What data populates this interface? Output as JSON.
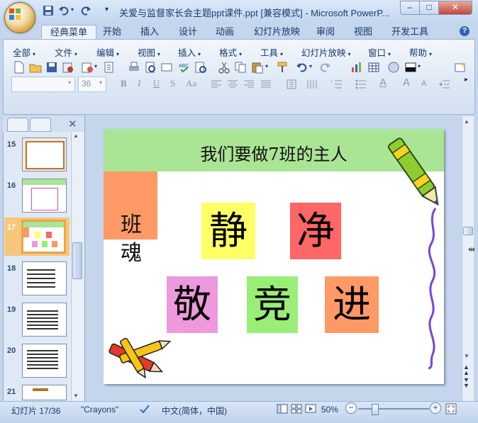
{
  "window": {
    "title": "关爱与监督家长会主题ppt课件.ppt [兼容模式] - Microsoft PowerP...",
    "minimize": "–",
    "maximize": "□",
    "close": "✕"
  },
  "ribbon_tabs": [
    "经典菜单",
    "开始",
    "插入",
    "设计",
    "动画",
    "幻灯片放映",
    "审阅",
    "视图",
    "开发工具"
  ],
  "menu": [
    "全部",
    "文件",
    "编辑",
    "视图",
    "插入",
    "格式",
    "工具",
    "幻灯片放映",
    "窗口",
    "帮助"
  ],
  "font_size_value": "36",
  "thumbnails": [
    {
      "num": "15"
    },
    {
      "num": "16"
    },
    {
      "num": "17"
    },
    {
      "num": "18"
    },
    {
      "num": "19"
    },
    {
      "num": "20"
    },
    {
      "num": "21"
    }
  ],
  "slide": {
    "title": "我们要做7班的主人",
    "side_label_1": "班",
    "side_label_2": "魂",
    "boxes": [
      {
        "char": "静",
        "color": "#ffff66"
      },
      {
        "char": "净",
        "color": "#ff6666"
      },
      {
        "char": "敬",
        "color": "#ee99dd"
      },
      {
        "char": "竞",
        "color": "#99ee77"
      },
      {
        "char": "进",
        "color": "#ff9966"
      }
    ],
    "orange_block_color": "#ff9966"
  },
  "status": {
    "slide_info": "幻灯片 17/36",
    "theme": "\"Crayons\"",
    "language": "中文(简体，中国)",
    "zoom": "50%"
  },
  "colors": {
    "header_green": "#aae495",
    "accent_blue": "#15386b"
  }
}
